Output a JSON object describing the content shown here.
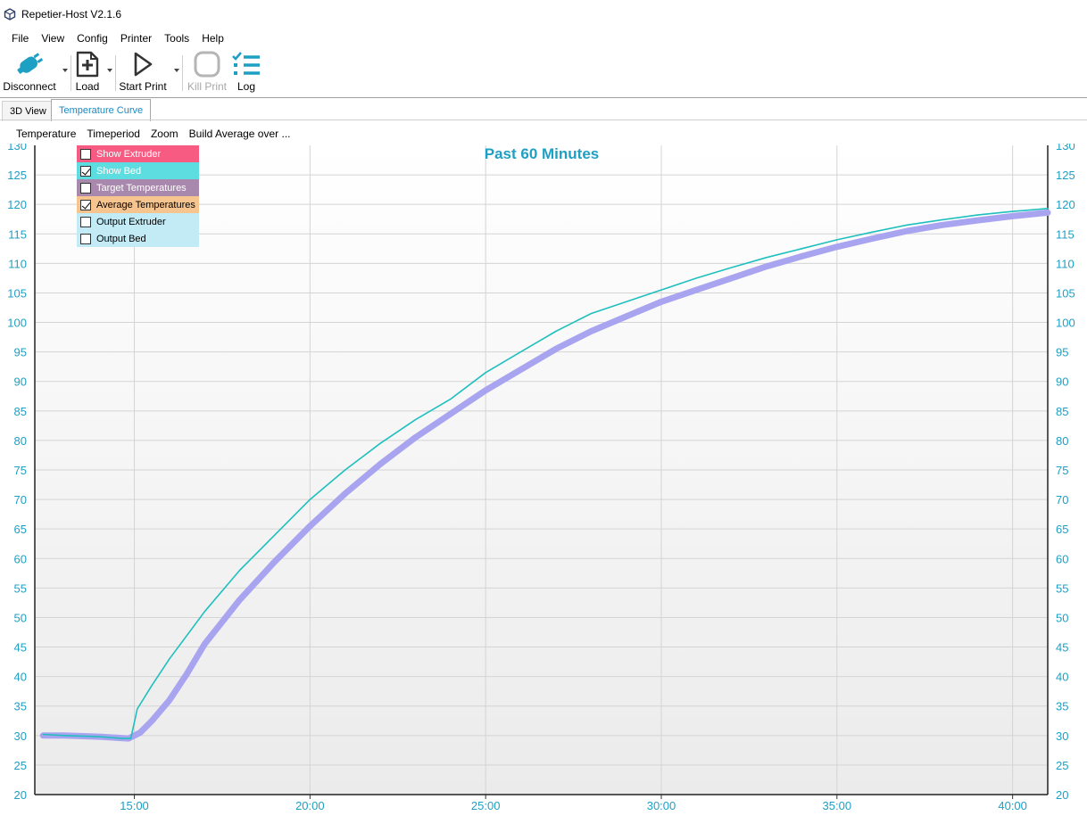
{
  "window": {
    "title": "Repetier-Host V2.1.6",
    "app_icon": "repetier-cube-icon"
  },
  "menubar": {
    "items": [
      "File",
      "View",
      "Config",
      "Printer",
      "Tools",
      "Help"
    ]
  },
  "toolbar": {
    "disconnect": {
      "label": "Disconnect",
      "icon": "plug-icon"
    },
    "load": {
      "label": "Load",
      "icon": "add-file-icon"
    },
    "start_print": {
      "label": "Start Print",
      "icon": "play-icon"
    },
    "kill_print": {
      "label": "Kill Print",
      "icon": "stop-icon",
      "enabled": false
    },
    "log": {
      "label": "Log",
      "icon": "checklist-icon"
    }
  },
  "tabs": [
    {
      "label": "3D View",
      "active": false
    },
    {
      "label": "Temperature Curve",
      "active": true
    }
  ],
  "chart_menu": {
    "items": [
      "Temperature",
      "Timeperiod",
      "Zoom",
      "Build Average over ..."
    ]
  },
  "legend": [
    {
      "label": "Show Extruder",
      "checked": false,
      "color": "#f75b82",
      "text_color": "#ffffff"
    },
    {
      "label": "Show Bed",
      "checked": true,
      "color": "#5ddde0",
      "text_color": "#ffffff"
    },
    {
      "label": "Target Temperatures",
      "checked": false,
      "color": "#a988ad",
      "text_color": "#ffffff"
    },
    {
      "label": "Average Temperatures",
      "checked": true,
      "color": "#f6c48f",
      "text_color": "#000000"
    },
    {
      "label": "Output Extruder",
      "checked": false,
      "color": "#c2ebf6",
      "text_color": "#000000"
    },
    {
      "label": "Output Bed",
      "checked": false,
      "color": "#c2ebf6",
      "text_color": "#000000"
    }
  ],
  "chart_data": {
    "type": "line",
    "title": "Past 60 Minutes",
    "xlabel": "",
    "ylabel": "",
    "xlim": [
      "12:10",
      "41:00"
    ],
    "x_ticks": [
      "15:00",
      "20:00",
      "25:00",
      "30:00",
      "35:00",
      "40:00"
    ],
    "ylim": [
      20,
      130
    ],
    "y_ticks": [
      20,
      25,
      30,
      35,
      40,
      45,
      50,
      55,
      60,
      65,
      70,
      75,
      80,
      85,
      90,
      95,
      100,
      105,
      110,
      115,
      120,
      125,
      130
    ],
    "grid": true,
    "accent_color": "#1e9fc4",
    "series": [
      {
        "name": "Bed",
        "color": "#1fbfbf",
        "x": [
          "12:24",
          "13:00",
          "14:00",
          "14:40",
          "14:54",
          "15:05",
          "15:30",
          "16:00",
          "17:00",
          "18:00",
          "19:00",
          "20:00",
          "21:00",
          "22:00",
          "23:00",
          "24:00",
          "25:00",
          "26:00",
          "27:00",
          "28:00",
          "29:00",
          "30:00",
          "31:00",
          "32:00",
          "33:00",
          "34:00",
          "35:00",
          "36:00",
          "37:00",
          "38:00",
          "39:00",
          "40:00",
          "41:00"
        ],
        "y": [
          30.2,
          30.0,
          29.8,
          29.5,
          29.5,
          34.5,
          38.5,
          43.0,
          51.0,
          58.0,
          64.0,
          70.0,
          75.0,
          79.5,
          83.5,
          87.0,
          91.5,
          95.0,
          98.5,
          101.5,
          103.5,
          105.5,
          107.5,
          109.3,
          111.0,
          112.5,
          114.0,
          115.3,
          116.5,
          117.4,
          118.2,
          118.8,
          119.3
        ]
      },
      {
        "name": "Bed Average",
        "color": "#a9a4ef",
        "x": [
          "12:24",
          "13:00",
          "14:00",
          "14:50",
          "15:10",
          "15:30",
          "16:00",
          "16:30",
          "17:00",
          "18:00",
          "19:00",
          "20:00",
          "21:00",
          "22:00",
          "23:00",
          "24:00",
          "25:00",
          "26:00",
          "27:00",
          "28:00",
          "29:00",
          "30:00",
          "31:00",
          "32:00",
          "33:00",
          "34:00",
          "35:00",
          "36:00",
          "37:00",
          "38:00",
          "39:00",
          "40:00",
          "41:00"
        ],
        "y": [
          30.0,
          30.0,
          29.8,
          29.5,
          30.5,
          32.5,
          36.0,
          40.5,
          45.5,
          53.0,
          59.5,
          65.5,
          71.0,
          76.0,
          80.5,
          84.5,
          88.5,
          92.0,
          95.5,
          98.5,
          101.0,
          103.5,
          105.5,
          107.5,
          109.5,
          111.2,
          112.8,
          114.2,
          115.5,
          116.5,
          117.3,
          118.0,
          118.6
        ]
      }
    ]
  }
}
